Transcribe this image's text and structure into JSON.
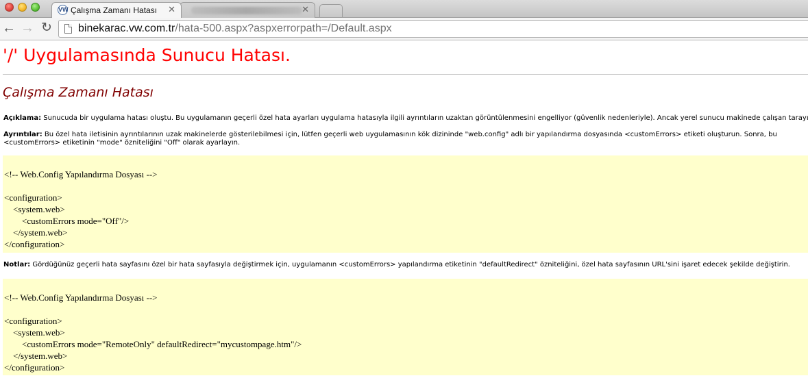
{
  "browser": {
    "tabs": [
      {
        "title": "Çalışma Zamanı Hatası",
        "active": true,
        "favicon": "vw-logo-icon"
      },
      {
        "title": "",
        "active": false,
        "blurred": true
      }
    ],
    "url": {
      "host": "binekarac.vw.com.tr",
      "path": "/hata-500.aspx?aspxerrorpath=/Default.aspx"
    },
    "icons": {
      "back": "←",
      "forward": "→",
      "reload": "↻",
      "close": "✕"
    }
  },
  "page": {
    "heading": "'/' Uygulamasında Sunucu Hatası.",
    "subheading": "Çalışma Zamanı Hatası",
    "description": {
      "label": "Açıklama:",
      "text": " Sunucuda bir uygulama hatası oluştu. Bu uygulamanın geçerli özel hata ayarları uygulama hatasıyla ilgili ayrıntıların uzaktan görüntülenmesini engelliyor (güvenlik nedenleriyle). Ancak yerel sunucu makinede çalışan tarayıcılarla gö"
    },
    "details": {
      "label": "Ayrıntılar:",
      "text": " Bu özel hata iletisinin ayrıntılarının uzak makinelerde gösterilebilmesi için, lütfen geçerli web uygulamasının kök dizininde \"web.config\" adlı bir yapılandırma dosyasında <customErrors> etiketi oluşturun. Sonra, bu <customErrors> etiketinin \"mode\" özniteliğini \"Off\" olarak ayarlayın."
    },
    "code1": "<!-- Web.Config Yapılandırma Dosyası -->\n\n<configuration>\n    <system.web>\n        <customErrors mode=\"Off\"/>\n    </system.web>\n</configuration>",
    "notes": {
      "label": "Notlar:",
      "text": " Gördüğünüz geçerli hata sayfasını özel bir hata sayfasıyla değiştirmek için, uygulamanın <customErrors> yapılandırma etiketinin \"defaultRedirect\" özniteliğini, özel hata sayfasının URL'sini işaret edecek şekilde değiştirin."
    },
    "code2": "<!-- Web.Config Yapılandırma Dosyası -->\n\n<configuration>\n    <system.web>\n        <customErrors mode=\"RemoteOnly\" defaultRedirect=\"mycustompage.htm\"/>\n    </system.web>\n</configuration>"
  },
  "colors": {
    "heading": "#ff0000",
    "subheading": "#800000",
    "code_background": "#ffffcc"
  }
}
